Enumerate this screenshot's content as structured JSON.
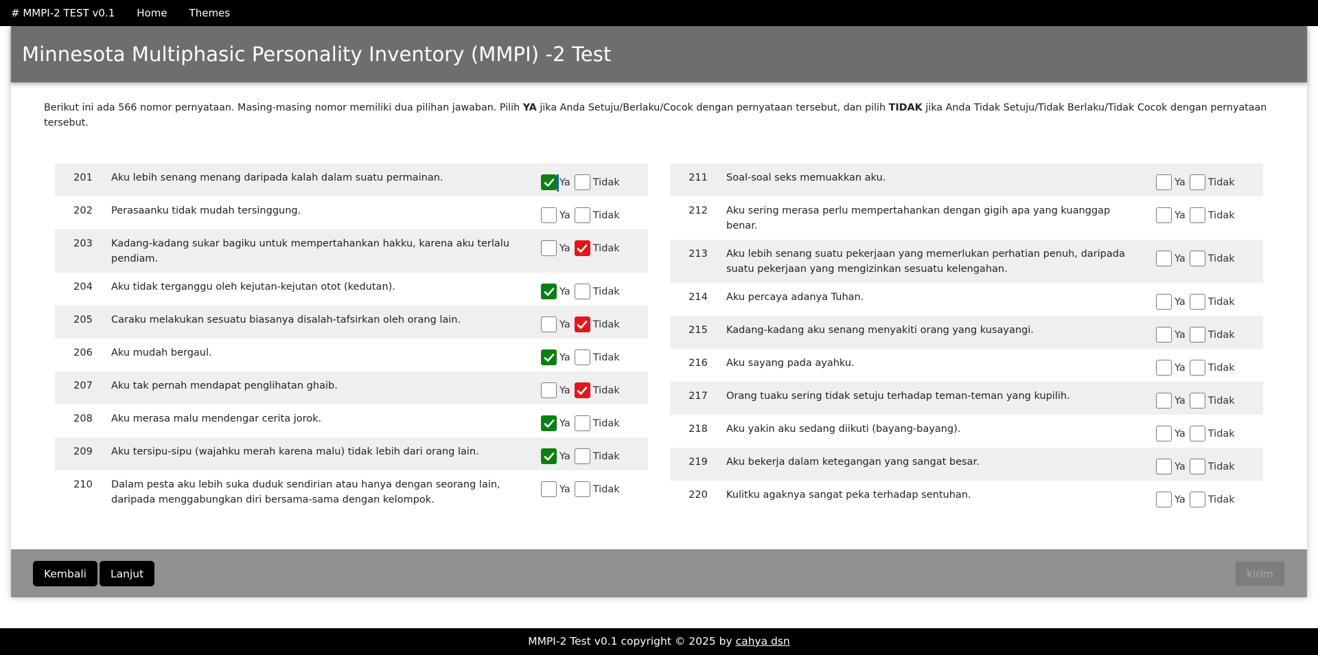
{
  "nav": {
    "brand": "# MMPI-2 TEST v0.1",
    "links": [
      "Home",
      "Themes"
    ]
  },
  "header": {
    "title": "Minnesota Multiphasic Personality Inventory (MMPI) -2 Test"
  },
  "intro": {
    "part1": "Berikut ini ada 566 nomor pernyataan. Masing-masing nomor memiliki dua pilihan jawaban. Pilih ",
    "ya": "YA",
    "part2": " jika Anda Setuju/Berlaku/Cocok dengan pernyataan tersebut, dan pilih ",
    "tidak": "TIDAK",
    "part3": " jika Anda Tidak Setuju/Tidak Berlaku/Tidak Cocok dengan pernyataan tersebut."
  },
  "labels": {
    "ya": "Ya",
    "tidak": "Tidak"
  },
  "colors": {
    "ya_checked": "#0d7f12",
    "tidak_checked": "#e8141c",
    "header_bg": "#6e6e6e",
    "footer_bar": "#919191"
  },
  "questions_left": [
    {
      "num": "201",
      "text": "Aku lebih senang menang daripada kalah dalam suatu permainan.",
      "answer": "ya"
    },
    {
      "num": "202",
      "text": "Perasaanku tidak mudah tersinggung.",
      "answer": ""
    },
    {
      "num": "203",
      "text": "Kadang-kadang sukar bagiku untuk mempertahankan hakku, karena aku terlalu pendiam.",
      "answer": "tidak"
    },
    {
      "num": "204",
      "text": "Aku tidak terganggu oleh kejutan-kejutan otot (kedutan).",
      "answer": "ya"
    },
    {
      "num": "205",
      "text": "Caraku melakukan sesuatu biasanya disalah-tafsirkan oleh orang lain.",
      "answer": "tidak"
    },
    {
      "num": "206",
      "text": "Aku mudah bergaul.",
      "answer": "ya"
    },
    {
      "num": "207",
      "text": "Aku tak pernah mendapat penglihatan ghaib.",
      "answer": "tidak"
    },
    {
      "num": "208",
      "text": "Aku merasa malu mendengar cerita jorok.",
      "answer": "ya"
    },
    {
      "num": "209",
      "text": "Aku tersipu-sipu (wajahku merah karena malu) tidak lebih dari orang lain.",
      "answer": "ya"
    },
    {
      "num": "210",
      "text": "Dalam pesta aku lebih suka duduk sendirian atau hanya dengan seorang lain, daripada menggabungkan diri bersama-sama dengan kelompok.",
      "answer": ""
    }
  ],
  "questions_right": [
    {
      "num": "211",
      "text": "Soal-soal seks memuakkan aku.",
      "answer": ""
    },
    {
      "num": "212",
      "text": "Aku sering merasa perlu mempertahankan dengan gigih apa yang kuanggap benar.",
      "answer": ""
    },
    {
      "num": "213",
      "text": "Aku lebih senang suatu pekerjaan yang memerlukan perhatian penuh, daripada suatu pekerjaan yang mengizinkan sesuatu kelengahan.",
      "answer": ""
    },
    {
      "num": "214",
      "text": "Aku percaya adanya Tuhan.",
      "answer": ""
    },
    {
      "num": "215",
      "text": "Kadang-kadang aku senang menyakiti orang yang kusayangi.",
      "answer": ""
    },
    {
      "num": "216",
      "text": "Aku sayang pada ayahku.",
      "answer": ""
    },
    {
      "num": "217",
      "text": "Orang tuaku sering tidak setuju terhadap teman-teman yang kupilih.",
      "answer": ""
    },
    {
      "num": "218",
      "text": "Aku yakin aku sedang diikuti (bayang-bayang).",
      "answer": ""
    },
    {
      "num": "219",
      "text": "Aku bekerja dalam ketegangan yang sangat besar.",
      "answer": ""
    },
    {
      "num": "220",
      "text": "Kulitku agaknya sangat peka terhadap sentuhan.",
      "answer": ""
    }
  ],
  "buttons": {
    "back": "Kembali",
    "next": "Lanjut",
    "submit": "kirim"
  },
  "footer": {
    "text": "MMPI-2 Test v0.1 copyright © 2025 by ",
    "author": "cahya dsn"
  }
}
